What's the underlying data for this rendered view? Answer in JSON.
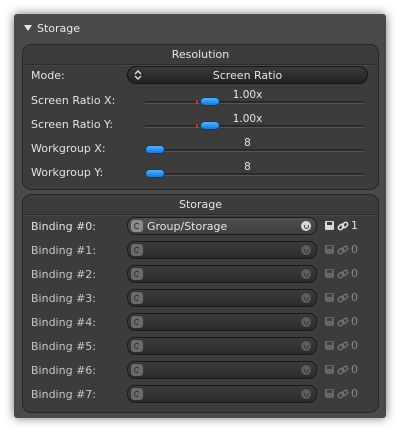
{
  "header": {
    "title": "Storage"
  },
  "resolution": {
    "title": "Resolution",
    "mode": {
      "label": "Mode:",
      "value": "Screen Ratio"
    },
    "sliders": [
      {
        "label": "Screen Ratio X:",
        "value": "1.00x",
        "fraction": 0.25
      },
      {
        "label": "Screen Ratio Y:",
        "value": "1.00x",
        "fraction": 0.25
      },
      {
        "label": "Workgroup X:",
        "value": "8",
        "fraction": 0.0
      },
      {
        "label": "Workgroup Y:",
        "value": "8",
        "fraction": 0.0
      }
    ]
  },
  "storage": {
    "title": "Storage",
    "bindings": [
      {
        "label": "Binding #0:",
        "value": "Group/Storage",
        "count": "1",
        "active": true
      },
      {
        "label": "Binding #1:",
        "value": "",
        "count": "0",
        "active": false
      },
      {
        "label": "Binding #2:",
        "value": "",
        "count": "0",
        "active": false
      },
      {
        "label": "Binding #3:",
        "value": "",
        "count": "0",
        "active": false
      },
      {
        "label": "Binding #4:",
        "value": "",
        "count": "0",
        "active": false
      },
      {
        "label": "Binding #5:",
        "value": "",
        "count": "0",
        "active": false
      },
      {
        "label": "Binding #6:",
        "value": "",
        "count": "0",
        "active": false
      },
      {
        "label": "Binding #7:",
        "value": "",
        "count": "0",
        "active": false
      }
    ]
  },
  "colors": {
    "accent": "#2a8ff0",
    "panel": "#3c3c3c",
    "window": "#4a4a4a"
  },
  "icons": {
    "collapse": "triangle-down-icon",
    "dropdown": "up-down-arrows-icon",
    "field": "resource-icon",
    "reset": "reset-icon",
    "save": "save-icon",
    "link": "link-icon"
  }
}
